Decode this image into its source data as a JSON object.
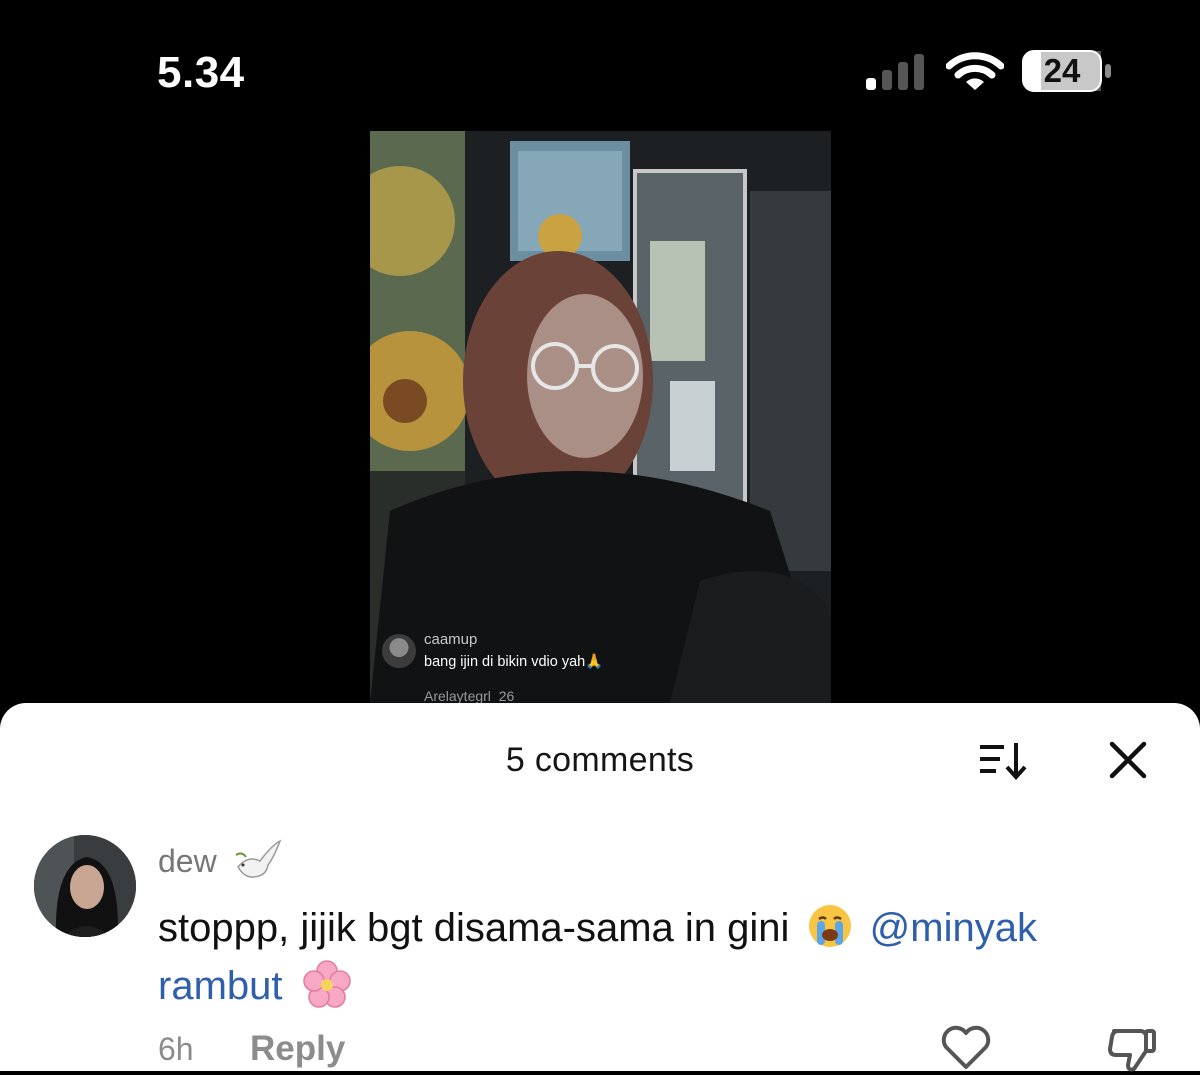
{
  "status_bar": {
    "time": "5.34",
    "battery": "24",
    "signal_bars_active": 1,
    "signal_bars_total": 4
  },
  "video": {
    "overlay_comment": {
      "username": "caamup",
      "message": "bang ijin di bikin vdio yah🙏"
    },
    "overlay_next_username": "Arelaytegrl_26"
  },
  "comments_sheet": {
    "title": "5 comments",
    "icons": {
      "sort": "sort-icon",
      "close": "close-icon",
      "like": "heart-icon",
      "dislike": "thumbs-down-icon"
    },
    "comment": {
      "username": "dew",
      "text_before": "stoppp, jijik bgt disama-sama in gini",
      "mention": "@minyak rambut",
      "time": "6h",
      "reply_label": "Reply"
    }
  },
  "colors": {
    "mention": "#2f5faa",
    "muted": "#8c8c8c",
    "background": "#000000",
    "sheet": "#ffffff"
  }
}
